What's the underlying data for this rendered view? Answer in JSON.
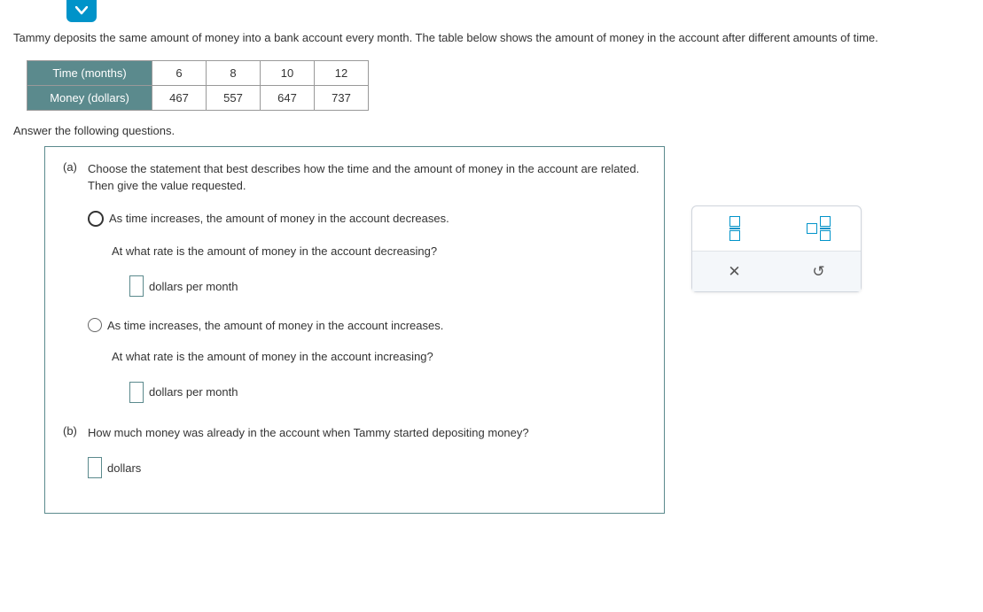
{
  "expand_arrow": "▾",
  "problem_text": "Tammy deposits the same amount of money into a bank account every month. The table below shows the amount of money in the account after different amounts of time.",
  "table": {
    "row1_label": "Time (months)",
    "row1": [
      "6",
      "8",
      "10",
      "12"
    ],
    "row2_label": "Money (dollars)",
    "row2": [
      "467",
      "557",
      "647",
      "737"
    ]
  },
  "answer_prompt": "Answer the following questions.",
  "part_a": {
    "marker": "(a)",
    "prompt": "Choose the statement that best describes how the time and the amount of money in the account are related. Then give the value requested.",
    "option1": "As time increases, the amount of money in the account decreases.",
    "q1": "At what rate is the amount of money in the account decreasing?",
    "unit1": "dollars per month",
    "option2": "As time increases, the amount of money in the account increases.",
    "q2": "At what rate is the amount of money in the account increasing?",
    "unit2": "dollars per month"
  },
  "part_b": {
    "marker": "(b)",
    "prompt": "How much money was already in the account when Tammy started depositing money?",
    "unit": "dollars"
  },
  "tools": {
    "x": "✕",
    "reset": "↺"
  }
}
